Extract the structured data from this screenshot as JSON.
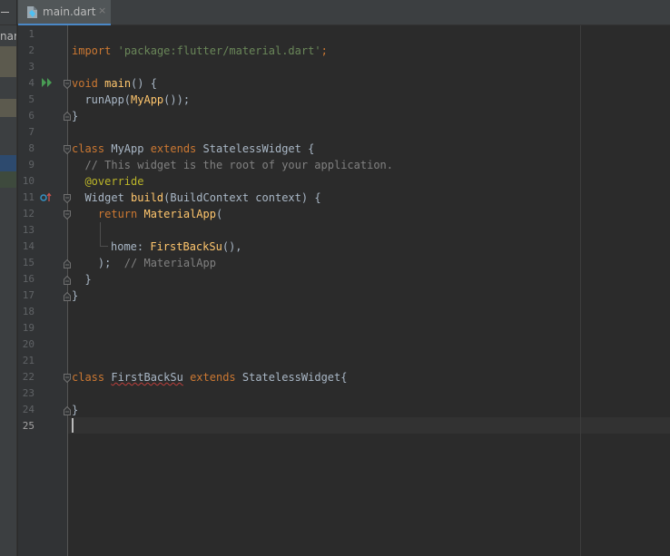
{
  "editor_tab": {
    "filename": "main.dart",
    "close_glyph": "×",
    "icon": "dart-file-icon"
  },
  "side_panel": {
    "label_fragment": "nar"
  },
  "gutter": {
    "line_numbers": [
      "1",
      "2",
      "3",
      "4",
      "5",
      "6",
      "7",
      "8",
      "9",
      "10",
      "11",
      "12",
      "13",
      "14",
      "15",
      "16",
      "17",
      "18",
      "19",
      "20",
      "21",
      "22",
      "23",
      "24",
      "25"
    ],
    "current_line": "25",
    "icons": [
      "run-icon",
      "override-marker-icon",
      "fold-marker-icon"
    ]
  },
  "code": {
    "l2": [
      "import",
      " ",
      "'package:flutter/material.dart'",
      ";"
    ],
    "l4": [
      "void",
      " ",
      "main",
      "() {"
    ],
    "l5": [
      "  runApp(",
      "MyApp",
      "());"
    ],
    "l6": [
      "}"
    ],
    "l8": [
      "class",
      " MyApp ",
      "extends",
      " StatelessWidget {"
    ],
    "l9": [
      "  // This widget is the root of your application."
    ],
    "l10": [
      "  ",
      "@override"
    ],
    "l11": [
      "  Widget ",
      "build",
      "(BuildContext context) {"
    ],
    "l12": [
      "    ",
      "return",
      " ",
      "MaterialApp",
      "("
    ],
    "l14": [
      "home: ",
      "FirstBackSu",
      "(),"
    ],
    "l15": [
      "    );  ",
      "// MaterialApp"
    ],
    "l16": [
      "  }"
    ],
    "l17": [
      "}"
    ],
    "l22": [
      "class",
      " ",
      "FirstBackSu",
      " ",
      "extends",
      " StatelessWidget{"
    ],
    "l24": [
      "}"
    ],
    "l25": [
      ""
    ]
  },
  "colors": {
    "background": "#2b2b2b",
    "keyword": "#cc7832",
    "string": "#6a8759",
    "function": "#ffc66d",
    "comment": "#808080",
    "annotation": "#bbb529",
    "plain": "#a9b7c6",
    "error_underline": "#bc3f3c",
    "run_icon": "#499c54",
    "override_icon": "#3592c4"
  }
}
